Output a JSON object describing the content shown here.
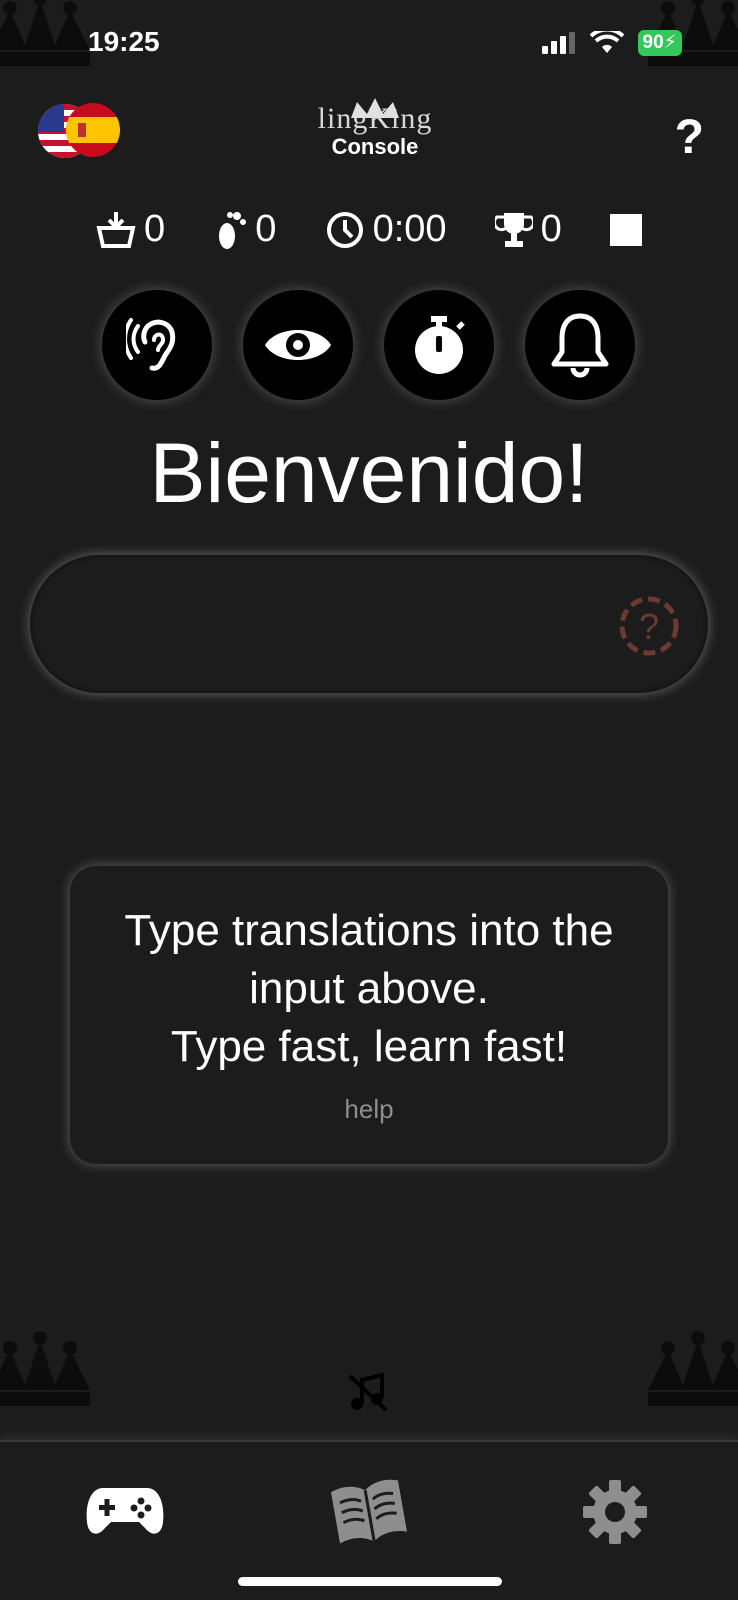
{
  "status_bar": {
    "time": "19:25",
    "battery": "90"
  },
  "header": {
    "logo_text": "lingKing",
    "logo_subtitle": "Console",
    "help_label": "?"
  },
  "stats": {
    "words": "0",
    "steps": "0",
    "time": "0:00",
    "trophies": "0"
  },
  "welcome": "Bienvenido!",
  "answer_input": {
    "value": "",
    "placeholder": ""
  },
  "info_card": {
    "text": "Type translations into the\ninput above.\nType fast, learn fast!",
    "help_link": "help"
  },
  "colors": {
    "battery": "#34c759",
    "hint_icon": "#6b3a33",
    "background": "#1c1c1c"
  }
}
